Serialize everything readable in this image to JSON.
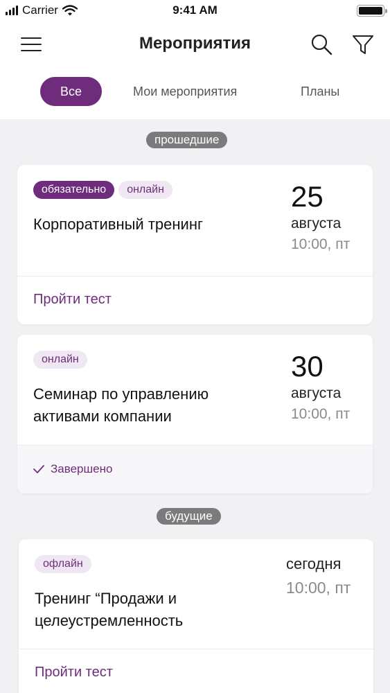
{
  "status_bar": {
    "carrier": "Carrier",
    "time": "9:41 AM"
  },
  "header": {
    "title": "Мероприятия"
  },
  "tabs": [
    {
      "label": "Все",
      "active": true
    },
    {
      "label": "Мои мероприятия",
      "active": false
    },
    {
      "label": "Планы",
      "active": false
    }
  ],
  "sections": {
    "past": "прошедшие",
    "future": "будущие"
  },
  "events": [
    {
      "tags": [
        "обязательно",
        "онлайн"
      ],
      "title": "Корпоративный тренинг",
      "day": "25",
      "month": "августа",
      "time": "10:00, пт",
      "action": "Пройти тест"
    },
    {
      "tags": [
        "онлайн"
      ],
      "title": "Семинар по управлению активами компании",
      "day": "30",
      "month": "августа",
      "time": "10:00, пт",
      "status": "Завершено"
    },
    {
      "tags": [
        "офлайн"
      ],
      "title": "Тренинг “Продажи и целеустремленность",
      "day_label": "сегодня",
      "time": "10:00, пт",
      "action": "Пройти тест"
    }
  ],
  "colors": {
    "accent": "#6f2c7d",
    "tag_bg": "#efe7f1",
    "section_pill": "#7b7b7e",
    "background": "#f1f1f4"
  },
  "icons": [
    "signal-icon",
    "wifi-icon",
    "battery-icon",
    "menu-icon",
    "search-icon",
    "filter-icon",
    "check-icon"
  ]
}
